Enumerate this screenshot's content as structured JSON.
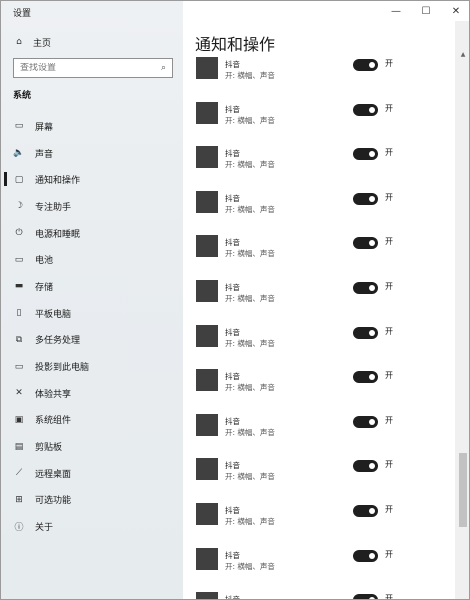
{
  "window": {
    "title": "设置",
    "controls": {
      "minimize": "—",
      "maximize": "☐",
      "close": "✕"
    }
  },
  "sidebar": {
    "home_label": "主页",
    "search_placeholder": "查找设置",
    "section_title": "系统",
    "items": [
      {
        "label": "屏幕",
        "icon": "display-icon",
        "glyph": "▭"
      },
      {
        "label": "声音",
        "icon": "speaker-icon",
        "glyph": "🔈"
      },
      {
        "label": "通知和操作",
        "icon": "notification-icon",
        "glyph": "▢",
        "active": true
      },
      {
        "label": "专注助手",
        "icon": "moon-icon",
        "glyph": "☽"
      },
      {
        "label": "电源和睡眠",
        "icon": "power-icon",
        "glyph": "⏻"
      },
      {
        "label": "电池",
        "icon": "battery-icon",
        "glyph": "▭"
      },
      {
        "label": "存储",
        "icon": "storage-icon",
        "glyph": "▬"
      },
      {
        "label": "平板电脑",
        "icon": "tablet-icon",
        "glyph": "▯"
      },
      {
        "label": "多任务处理",
        "icon": "multitask-icon",
        "glyph": "⧉"
      },
      {
        "label": "投影到此电脑",
        "icon": "project-icon",
        "glyph": "▭"
      },
      {
        "label": "体验共享",
        "icon": "share-icon",
        "glyph": "✕"
      },
      {
        "label": "系统组件",
        "icon": "components-icon",
        "glyph": "▣"
      },
      {
        "label": "剪贴板",
        "icon": "clipboard-icon",
        "glyph": "▤"
      },
      {
        "label": "远程桌面",
        "icon": "remote-icon",
        "glyph": "⟋"
      },
      {
        "label": "可选功能",
        "icon": "features-icon",
        "glyph": "⊞"
      },
      {
        "label": "关于",
        "icon": "info-icon",
        "glyph": "ⓘ"
      }
    ]
  },
  "main": {
    "title": "通知和操作",
    "apps": [
      {
        "name": "抖音",
        "sub": "开: 横幅、声音",
        "state": "开"
      },
      {
        "name": "抖音",
        "sub": "开: 横幅、声音",
        "state": "开"
      },
      {
        "name": "抖音",
        "sub": "开: 横幅、声音",
        "state": "开"
      },
      {
        "name": "抖音",
        "sub": "开: 横幅、声音",
        "state": "开"
      },
      {
        "name": "抖音",
        "sub": "开: 横幅、声音",
        "state": "开"
      },
      {
        "name": "抖音",
        "sub": "开: 横幅、声音",
        "state": "开"
      },
      {
        "name": "抖音",
        "sub": "开: 横幅、声音",
        "state": "开"
      },
      {
        "name": "抖音",
        "sub": "开: 横幅、声音",
        "state": "开"
      },
      {
        "name": "抖音",
        "sub": "开: 横幅、声音",
        "state": "开"
      },
      {
        "name": "抖音",
        "sub": "开: 横幅、声音",
        "state": "开"
      },
      {
        "name": "抖音",
        "sub": "开: 横幅、声音",
        "state": "开"
      },
      {
        "name": "抖音",
        "sub": "开: 横幅、声音",
        "state": "开"
      },
      {
        "name": "抖音",
        "sub": "",
        "state": "开"
      }
    ]
  }
}
